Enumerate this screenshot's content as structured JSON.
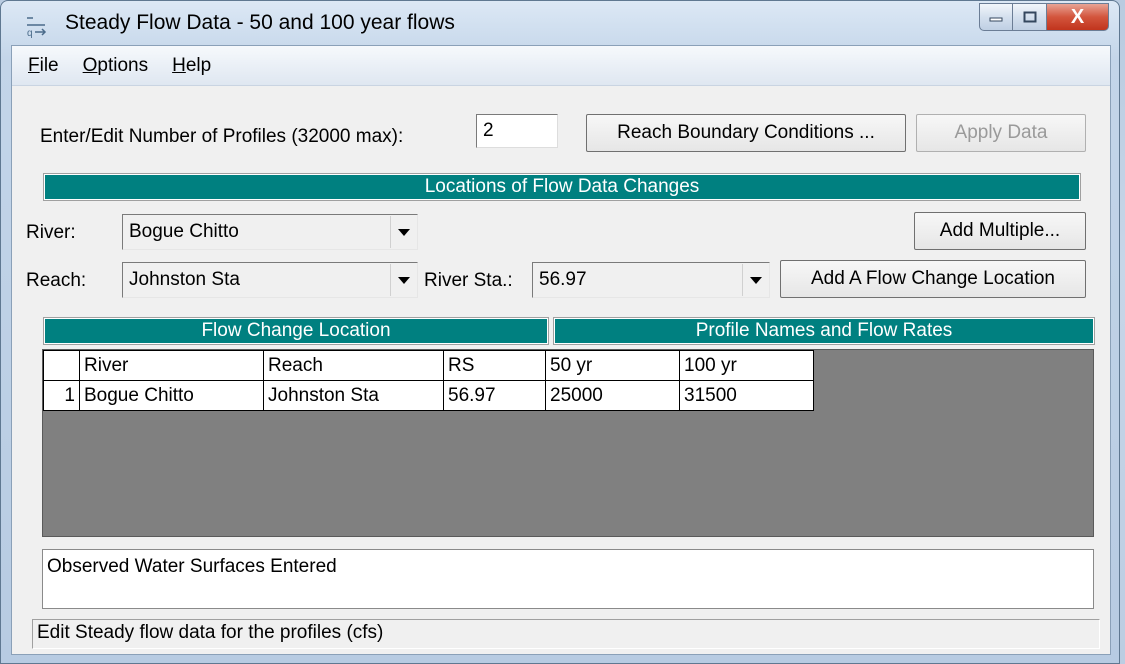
{
  "window": {
    "title": "Steady Flow Data - 50 and 100 year flows",
    "icon": "hec-ras-flow-icon"
  },
  "caption": {
    "minimize": "minimize-icon",
    "maximize": "maximize-icon",
    "close_glyph": "X"
  },
  "menu": [
    {
      "accel": "F",
      "rest": "ile"
    },
    {
      "accel": "O",
      "rest": "ptions"
    },
    {
      "accel": "H",
      "rest": "elp"
    }
  ],
  "profiles": {
    "label": "Enter/Edit Number of Profiles (32000 max):",
    "value": "2"
  },
  "buttons": {
    "reach_boundary": "Reach Boundary Conditions ...",
    "apply_data": "Apply Data",
    "add_multiple": "Add Multiple...",
    "add_flow_change": "Add A Flow Change Location"
  },
  "locations": {
    "header": "Locations of Flow Data Changes",
    "river_label": "River:",
    "river_value": "Bogue Chitto",
    "reach_label": "Reach:",
    "reach_value": "Johnston Sta",
    "station_label": "River Sta.:",
    "station_value": "56.97"
  },
  "grid": {
    "left_header": "Flow Change Location",
    "right_header": "Profile Names and Flow Rates",
    "columns": [
      "River",
      "Reach",
      "RS",
      "50 yr",
      "100 yr"
    ],
    "rows": [
      {
        "num": "1",
        "river": "Bogue Chitto",
        "reach": "Johnston Sta",
        "rs": "56.97",
        "p1": "25000",
        "p2": "31500"
      }
    ]
  },
  "notes": "Observed Water Surfaces Entered",
  "status": "Edit Steady flow data for the profiles (cfs)",
  "colors": {
    "section_header": "#008080",
    "grid_background": "#808080",
    "close_button": "#c1341d"
  }
}
